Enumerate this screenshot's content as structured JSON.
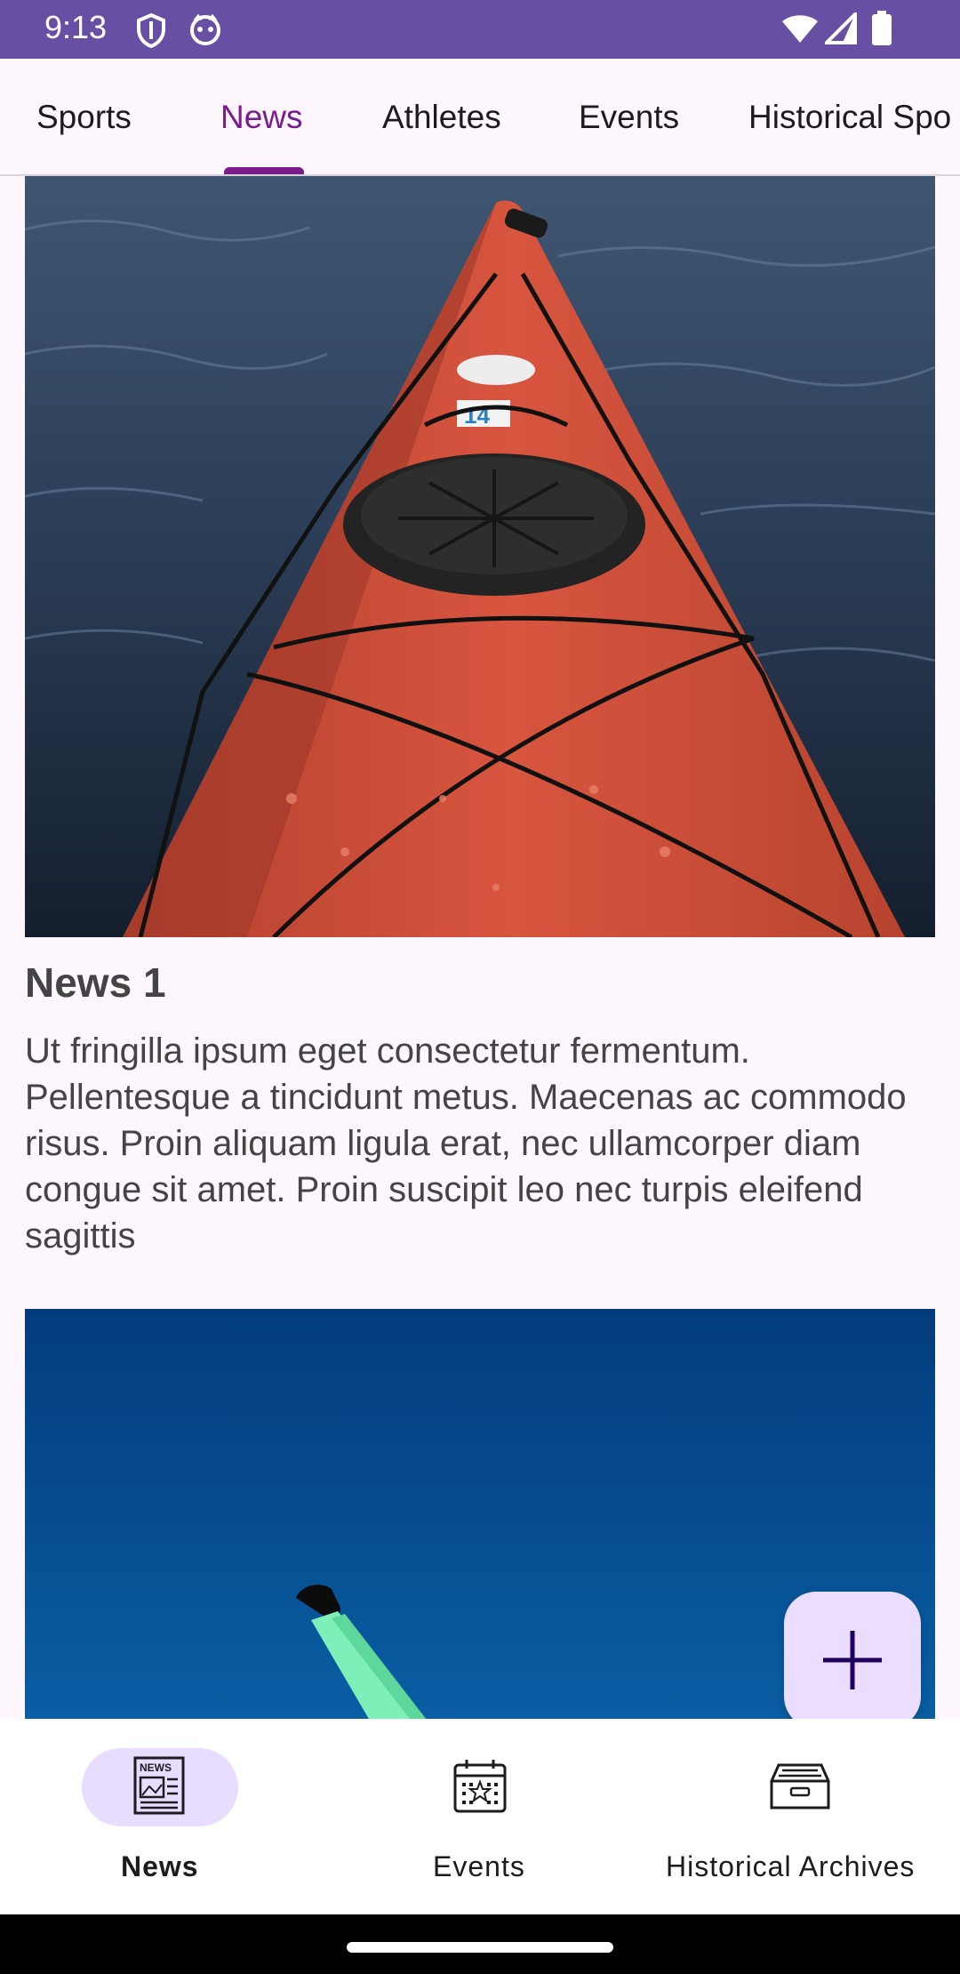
{
  "status_bar": {
    "time": "9:13",
    "icons": [
      "shield-icon",
      "app-cat-icon",
      "wifi-icon",
      "cell-signal-icon",
      "battery-icon"
    ],
    "background": "#6750A4"
  },
  "tabs": {
    "items": [
      {
        "label": "Sports"
      },
      {
        "label": "News"
      },
      {
        "label": "Athletes"
      },
      {
        "label": "Events"
      },
      {
        "label": "Historical Spo"
      }
    ],
    "selected": "News",
    "accent": "#7A1B8E"
  },
  "news": [
    {
      "title": "News 1",
      "body": "Ut fringilla ipsum eget consectetur fermentum. Pellentesque a tincidunt metus. Maecenas ac commodo risus. Proin aliquam ligula erat, nec ullamcorper diam congue sit amet. Proin suscipit leo nec turpis eleifend sagittis",
      "image": "kayak-photo"
    },
    {
      "title": "",
      "body": "",
      "image": "athlete-sky-photo"
    }
  ],
  "fab": {
    "icon": "plus-icon",
    "color": "#EADDFF"
  },
  "bottom_nav": {
    "items": [
      {
        "label": "News",
        "icon": "newspaper-icon",
        "selected": true
      },
      {
        "label": "Events",
        "icon": "calendar-star-icon",
        "selected": false
      },
      {
        "label": "Historical Archives",
        "icon": "archive-box-icon",
        "selected": false
      }
    ]
  }
}
